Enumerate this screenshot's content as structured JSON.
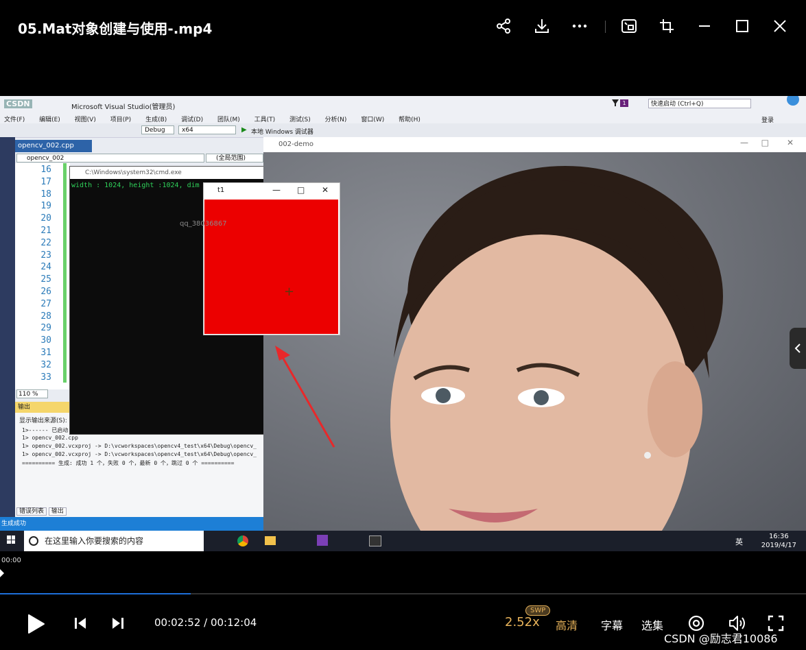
{
  "player": {
    "title": "05.Mat对象创建与使用-.mp4",
    "elapsed_small": "00:00",
    "time_display": "00:02:52 / 00:12:04",
    "progress_fraction": 0.237,
    "speed": "2.52x",
    "speed_badge": "SWP",
    "quality": "高清",
    "subtitles": "字幕",
    "episodes": "选集",
    "watermark": "CSDN @励志君10086",
    "accent_color": "#e8b35a",
    "progress_color": "#1e6fd9",
    "icons": [
      "share-icon",
      "download-icon",
      "more-icon",
      "pip-icon",
      "fullscreen-mini-icon",
      "minimize-icon",
      "maximize-icon",
      "close-icon",
      "play-icon",
      "prev-icon",
      "next-icon",
      "danmaku-icon",
      "volume-icon",
      "fullscreen-icon"
    ]
  },
  "video": {
    "vs": {
      "title": "Microsoft Visual Studio(管理员)",
      "csdn_logo": "CSDN",
      "quick_launch": "快速启动 (Ctrl+Q)",
      "login": "登录",
      "menu": [
        "文件(F)",
        "编辑(E)",
        "视图(V)",
        "项目(P)",
        "生成(B)",
        "调试(D)",
        "团队(M)",
        "工具(T)",
        "测试(S)",
        "分析(N)",
        "窗口(W)",
        "帮助(H)"
      ],
      "config": "Debug",
      "platform": "x64",
      "run_label": "本地 Windows 调试器",
      "file_tab": "opencv_002.cpp",
      "project_drop": "opencv_002",
      "scope_drop": "(全局范围)",
      "line_numbers": [
        "16",
        "17",
        "18",
        "19",
        "20",
        "21",
        "22",
        "23",
        "24",
        "25",
        "26",
        "27",
        "28",
        "29",
        "30",
        "31",
        "32",
        "33"
      ],
      "zoom": "110 %",
      "output_header": "输出",
      "output_source": "显示输出来源(S):",
      "output_lines": [
        "1>------ 已启动",
        "1>  opencv_002.cpp",
        "1>  opencv_002.vcxproj -> D:\\vcworkspaces\\opencv4_test\\x64\\Debug\\opencv_",
        "1>  opencv_002.vcxproj -> D:\\vcworkspaces\\opencv4_test\\x64\\Debug\\opencv_",
        "========== 生成: 成功 1 个，失败 0 个，最新 0 个，跳过 0 个 =========="
      ],
      "bottom_tabs": [
        "错误列表",
        "输出"
      ],
      "status": "生成成功"
    },
    "cmd": {
      "title": "C:\\Windows\\system32\\cmd.exe",
      "output": "width : 1024, height :1024, dim"
    },
    "t1_window": {
      "title": "t1",
      "fill_color": "#ec0000",
      "watermark": "qq_38036867"
    },
    "demo_window": {
      "title": "002-demo"
    },
    "taskbar": {
      "search_placeholder": "在这里输入你要搜索的内容",
      "time": "16:36",
      "date": "2019/4/17",
      "ime": "英"
    }
  }
}
